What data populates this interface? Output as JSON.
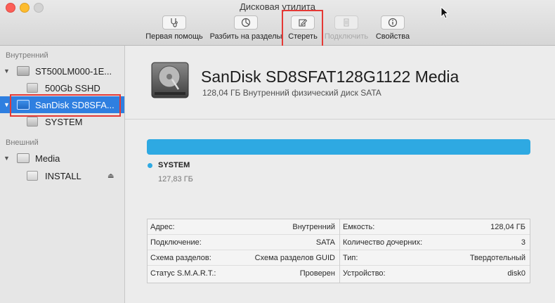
{
  "window": {
    "title": "Дисковая утилита"
  },
  "toolbar": {
    "first_aid": "Первая помощь",
    "partition": "Разбить на разделы",
    "erase": "Стереть",
    "mount": "Подключить",
    "info": "Свойства"
  },
  "sidebar": {
    "internal_header": "Внутренний",
    "external_header": "Внешний",
    "items": [
      {
        "label": "ST500LM000-1E..."
      },
      {
        "label": "500Gb SSHD"
      },
      {
        "label": "SanDisk SD8SFA..."
      },
      {
        "label": "SYSTEM"
      },
      {
        "label": "Media"
      },
      {
        "label": "INSTALL"
      }
    ]
  },
  "main": {
    "disk_name": "SanDisk SD8SFAT128G1122 Media",
    "disk_subtitle": "128,04 ГБ Внутренний физический диск SATA",
    "usage_fraction": 1.0,
    "legend_name": "SYSTEM",
    "legend_size": "127,83 ГБ",
    "info_left": [
      {
        "key": "Адрес:",
        "value": "Внутренний"
      },
      {
        "key": "Подключение:",
        "value": "SATA"
      },
      {
        "key": "Схема разделов:",
        "value": "Схема разделов GUID"
      },
      {
        "key": "Статус S.M.A.R.T.:",
        "value": "Проверен"
      }
    ],
    "info_right": [
      {
        "key": "Емкость:",
        "value": "128,04 ГБ"
      },
      {
        "key": "Количество дочерних:",
        "value": "3"
      },
      {
        "key": "Тип:",
        "value": "Твердотельный"
      },
      {
        "key": "Устройство:",
        "value": "disk0"
      }
    ]
  },
  "colors": {
    "selection": "#2f7fe0",
    "usage": "#2ea9e2",
    "highlight_box": "#e53935"
  }
}
